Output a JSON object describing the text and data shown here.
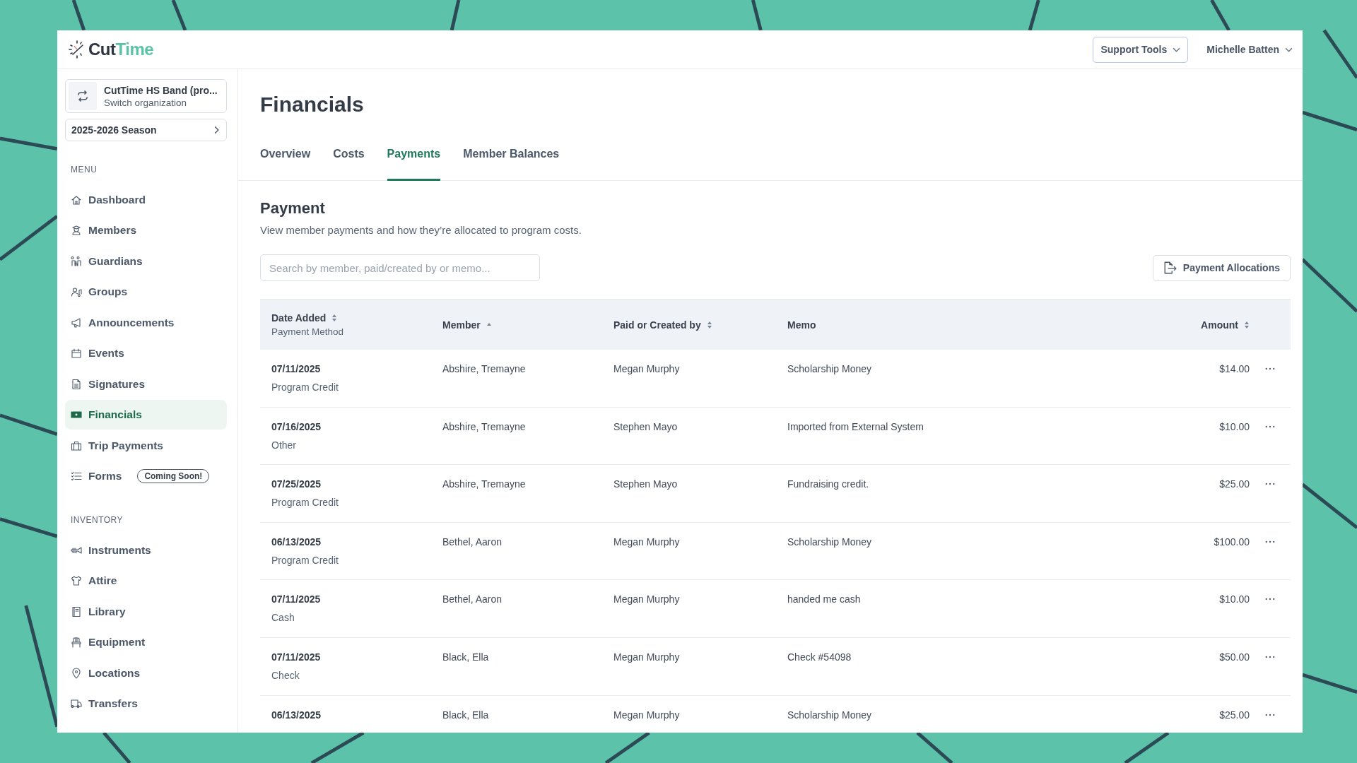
{
  "header": {
    "logo": {
      "dark": "Cut",
      "accent": "Time"
    },
    "support_button": "Support Tools",
    "user_menu": "Michelle Batten"
  },
  "sidebar": {
    "organization": {
      "name": "CutTime HS Band (pro...",
      "subtitle": "Switch organization"
    },
    "season": "2025-2026 Season",
    "sections": [
      {
        "heading": "MENU",
        "items": [
          {
            "label": "Dashboard",
            "selected": false
          },
          {
            "label": "Members",
            "selected": false
          },
          {
            "label": "Guardians",
            "selected": false
          },
          {
            "label": "Groups",
            "selected": false
          },
          {
            "label": "Announcements",
            "selected": false
          },
          {
            "label": "Events",
            "selected": false
          },
          {
            "label": "Signatures",
            "selected": false
          },
          {
            "label": "Financials",
            "selected": true
          },
          {
            "label": "Trip Payments",
            "selected": false
          },
          {
            "label": "Forms",
            "selected": false,
            "badge": "Coming Soon!"
          }
        ]
      },
      {
        "heading": "INVENTORY",
        "items": [
          {
            "label": "Instruments",
            "selected": false
          },
          {
            "label": "Attire",
            "selected": false
          },
          {
            "label": "Library",
            "selected": false
          },
          {
            "label": "Equipment",
            "selected": false
          },
          {
            "label": "Locations",
            "selected": false
          },
          {
            "label": "Transfers",
            "selected": false
          }
        ]
      }
    ]
  },
  "page": {
    "title": "Financials",
    "tabs": [
      {
        "label": "Overview",
        "selected": false
      },
      {
        "label": "Costs",
        "selected": false
      },
      {
        "label": "Payments",
        "selected": true
      },
      {
        "label": "Member Balances",
        "selected": false
      }
    ],
    "section": {
      "title": "Payment",
      "description": "View member payments and how they’re allocated to program costs."
    },
    "search": {
      "placeholder": "Search by member, paid/created by or memo..."
    },
    "allocations_button": "Payment Allocations",
    "table": {
      "columns": [
        {
          "label": "Date Added",
          "sublabel": "Payment Method",
          "kind": "sortable"
        },
        {
          "label": "Member",
          "kind": "sorted"
        },
        {
          "label": "Paid or Created by",
          "kind": "sortable"
        },
        {
          "label": "Memo",
          "kind": "plain"
        },
        {
          "label": "Amount",
          "kind": "sortable"
        }
      ],
      "rows": [
        {
          "date": "07/11/2025",
          "method": "Program Credit",
          "member": "Abshire, Tremayne",
          "paid_by": "Megan Murphy",
          "memo": "Scholarship Money",
          "amount": "$14.00"
        },
        {
          "date": "07/16/2025",
          "method": "Other",
          "member": "Abshire, Tremayne",
          "paid_by": "Stephen Mayo",
          "memo": "Imported from External System",
          "amount": "$10.00"
        },
        {
          "date": "07/25/2025",
          "method": "Program Credit",
          "member": "Abshire, Tremayne",
          "paid_by": "Stephen Mayo",
          "memo": "Fundraising credit.",
          "amount": "$25.00"
        },
        {
          "date": "06/13/2025",
          "method": "Program Credit",
          "member": "Bethel, Aaron",
          "paid_by": "Megan Murphy",
          "memo": "Scholarship Money",
          "amount": "$100.00"
        },
        {
          "date": "07/11/2025",
          "method": "Cash",
          "member": "Bethel, Aaron",
          "paid_by": "Megan Murphy",
          "memo": "handed me cash",
          "amount": "$10.00"
        },
        {
          "date": "07/11/2025",
          "method": "Check",
          "member": "Black, Ella",
          "paid_by": "Megan Murphy",
          "memo": "Check #54098",
          "amount": "$50.00"
        },
        {
          "date": "06/13/2025",
          "member": "Black, Ella",
          "paid_by": "Megan Murphy",
          "memo": "Scholarship Money",
          "amount": "$25.00"
        }
      ]
    }
  }
}
